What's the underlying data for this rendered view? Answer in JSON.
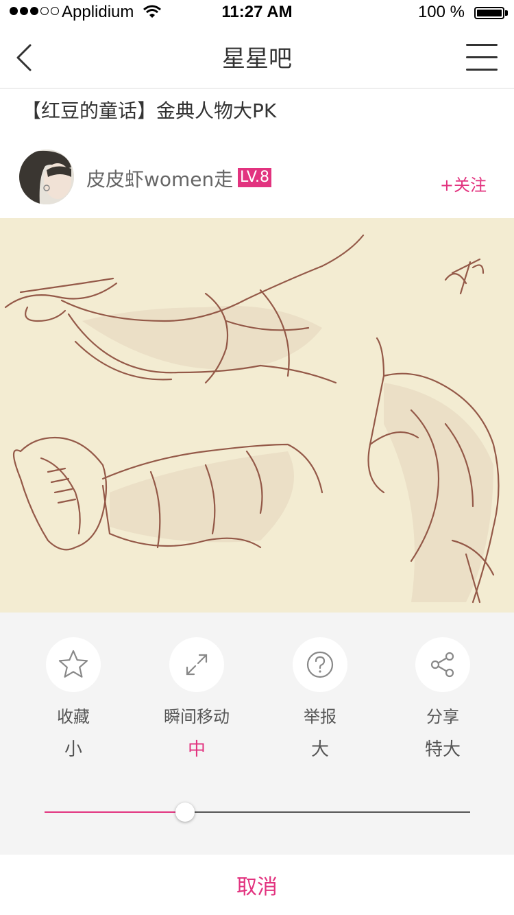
{
  "status_bar": {
    "carrier": "Applidium",
    "time": "11:27 AM",
    "battery": "100 %",
    "signal_strength": 3,
    "signal_max": 5
  },
  "nav": {
    "title": "星星吧",
    "back_icon": "chevron-left-icon",
    "menu_icon": "hamburger-menu-icon"
  },
  "post": {
    "title": "【红豆的童话】金典人物大PK",
    "author": "皮皮虾women走",
    "level": "LV.8",
    "follow_label": "+关注"
  },
  "sheet": {
    "actions": [
      {
        "label": "收藏",
        "icon": "star-icon",
        "size": "小"
      },
      {
        "label": "瞬间移动",
        "icon": "expand-icon",
        "size": "中"
      },
      {
        "label": "举报",
        "icon": "question-icon",
        "size": "大"
      },
      {
        "label": "分享",
        "icon": "share-icon",
        "size": "特大"
      }
    ],
    "active_size_index": 1,
    "slider_value": 0.33,
    "cancel_label": "取消"
  },
  "colors": {
    "accent": "#e2337f",
    "sheet_bg": "#f4f4f4",
    "illustration_bg": "#f3ecd2",
    "sketch_line": "#8a4a3a"
  }
}
